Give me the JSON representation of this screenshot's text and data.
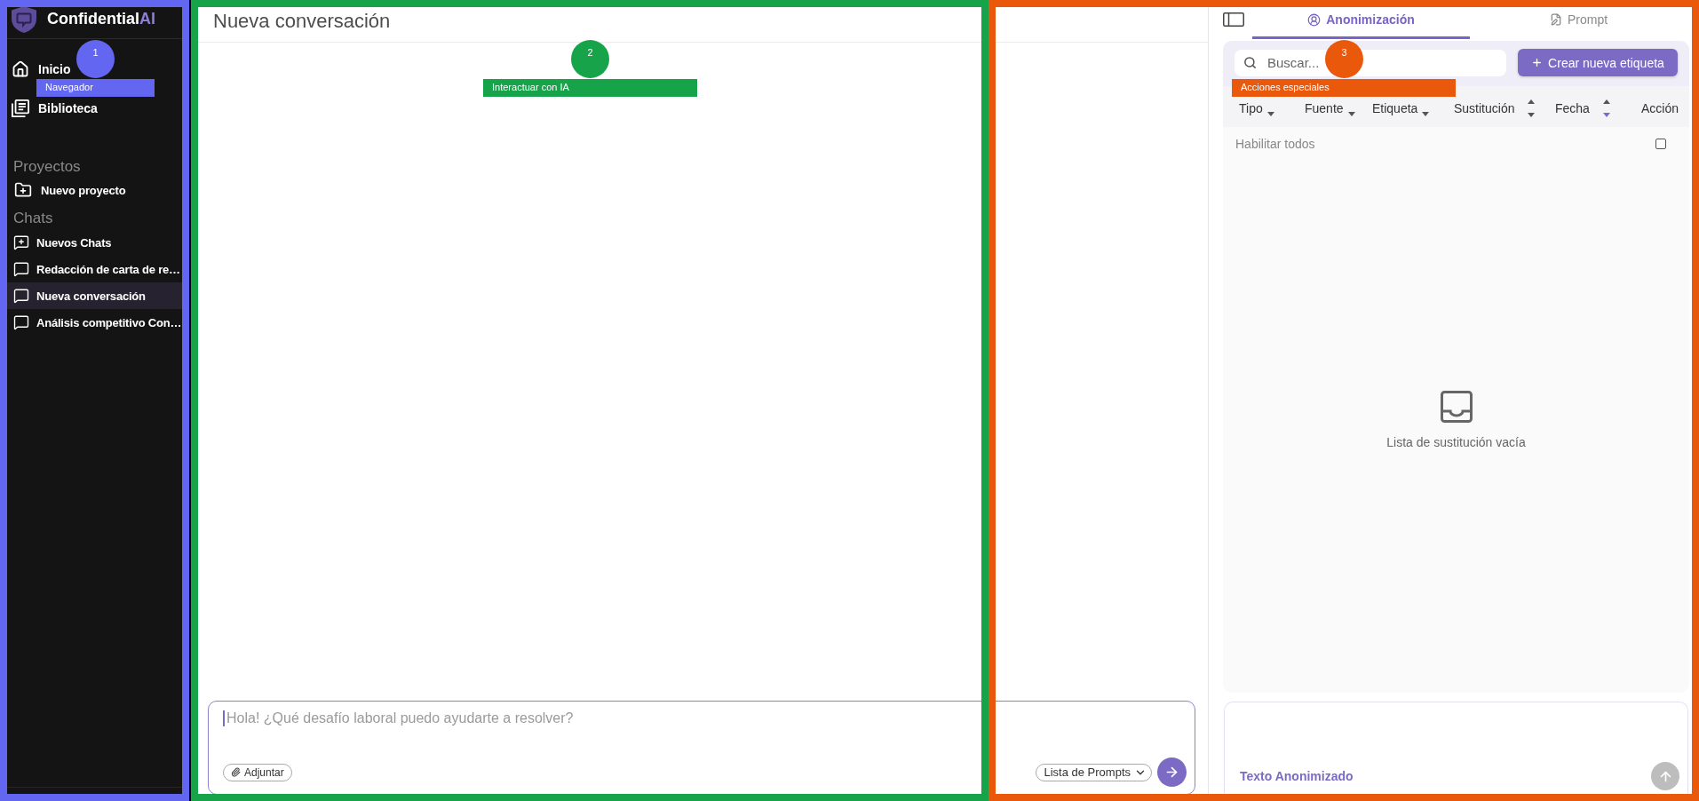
{
  "annotations": [
    {
      "number": "1",
      "label": "Navegador",
      "color": "#6366f1"
    },
    {
      "number": "2",
      "label": "Interactuar con IA",
      "color": "#16a34a"
    },
    {
      "number": "3",
      "label": "Acciones especiales",
      "color": "#ea580c"
    }
  ],
  "sidebar": {
    "brand": {
      "name": "Confidential",
      "accent": "AI"
    },
    "nav": [
      {
        "label": "Inicio",
        "selected": false
      },
      {
        "label": "Biblioteca",
        "selected": false
      }
    ],
    "sections": [
      {
        "title": "Proyectos",
        "items": [
          {
            "label": "Nuevo proyecto",
            "kind": "new-project",
            "selected": false
          }
        ]
      },
      {
        "title": "Chats",
        "items": [
          {
            "label": "Nuevos Chats",
            "kind": "new-chat",
            "selected": false
          },
          {
            "label": "Redacción de carta de re…",
            "kind": "chat",
            "selected": false
          },
          {
            "label": "Nueva conversación",
            "kind": "chat",
            "selected": true
          },
          {
            "label": "Análisis competitivo Con…",
            "kind": "chat",
            "selected": false
          }
        ]
      }
    ]
  },
  "chat": {
    "title": "Nueva conversación",
    "composer": {
      "placeholder": "Hola! ¿Qué desafío laboral puedo ayudarte a resolver?",
      "focused": true,
      "attach": "Adjuntar",
      "prompts": "Lista de Prompts"
    }
  },
  "panel": {
    "tabs": [
      {
        "label": "Anonimización",
        "selected": true
      },
      {
        "label": "Prompt",
        "selected": false
      }
    ],
    "search": {
      "placeholder": "Buscar..."
    },
    "create_button": "Crear nueva etiqueta",
    "columns": [
      {
        "label": "Tipo",
        "kind": "filter"
      },
      {
        "label": "Fuente",
        "kind": "filter"
      },
      {
        "label": "Etiqueta",
        "kind": "filter"
      },
      {
        "label": "Sustitución",
        "kind": "sort",
        "active": false
      },
      {
        "label": "Fecha",
        "kind": "sort",
        "active": true
      },
      {
        "label": "Acción",
        "kind": "plain"
      }
    ],
    "select_all": {
      "label": "Habilitar todos",
      "checked": false
    },
    "empty_message": "Lista de sustitución vacía",
    "output": {
      "label": "Texto Anonimizado",
      "disabled": true
    }
  }
}
